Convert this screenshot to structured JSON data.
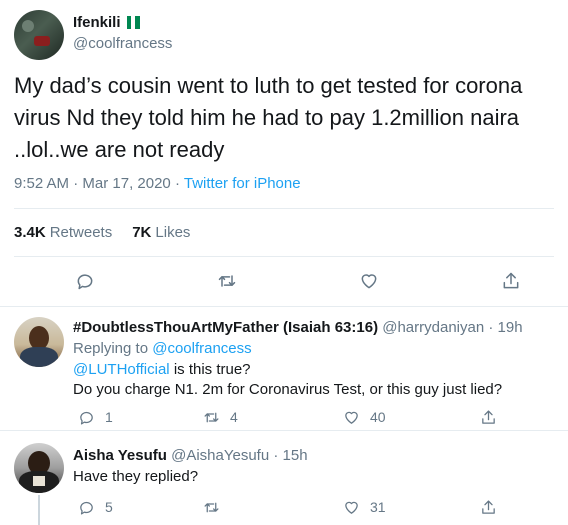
{
  "main_tweet": {
    "display_name": "Ifenkili",
    "handle": "@coolfrancess",
    "text": "My dad’s cousin went to luth to get tested for corona virus Nd they told him he had to pay 1.2million naira ..lol..we are not ready",
    "time": "9:52 AM",
    "date": "Mar 17, 2020",
    "source": "Twitter for iPhone",
    "retweets_count": "3.4K",
    "retweets_label": "Retweets",
    "likes_count": "7K",
    "likes_label": "Likes"
  },
  "replies": [
    {
      "display_name": "#DoubtlessThouArtMyFather (Isaiah 63:16)",
      "handle": "@harrydaniyan",
      "time": "19h",
      "replying_prefix": "Replying to",
      "replying_to": "@coolfrancess",
      "mention": "@LUTHofficial",
      "line1_rest": "is this true?",
      "line2": "Do you charge N1. 2m for Coronavirus Test, or this guy just lied?",
      "reply_count": "1",
      "retweet_count": "4",
      "like_count": "40"
    },
    {
      "display_name": "Aisha Yesufu",
      "handle": "@AishaYesufu",
      "time": "15h",
      "text": "Have they replied?",
      "reply_count": "5",
      "retweet_count": "",
      "like_count": "31"
    }
  ],
  "separator": "·",
  "colors": {
    "link": "#1da1f2",
    "muted": "#657786",
    "text": "#14171a",
    "border": "#e6ecf0",
    "flag_green": "#008751"
  },
  "icons": [
    "reply-icon",
    "retweet-icon",
    "like-icon",
    "share-icon"
  ]
}
